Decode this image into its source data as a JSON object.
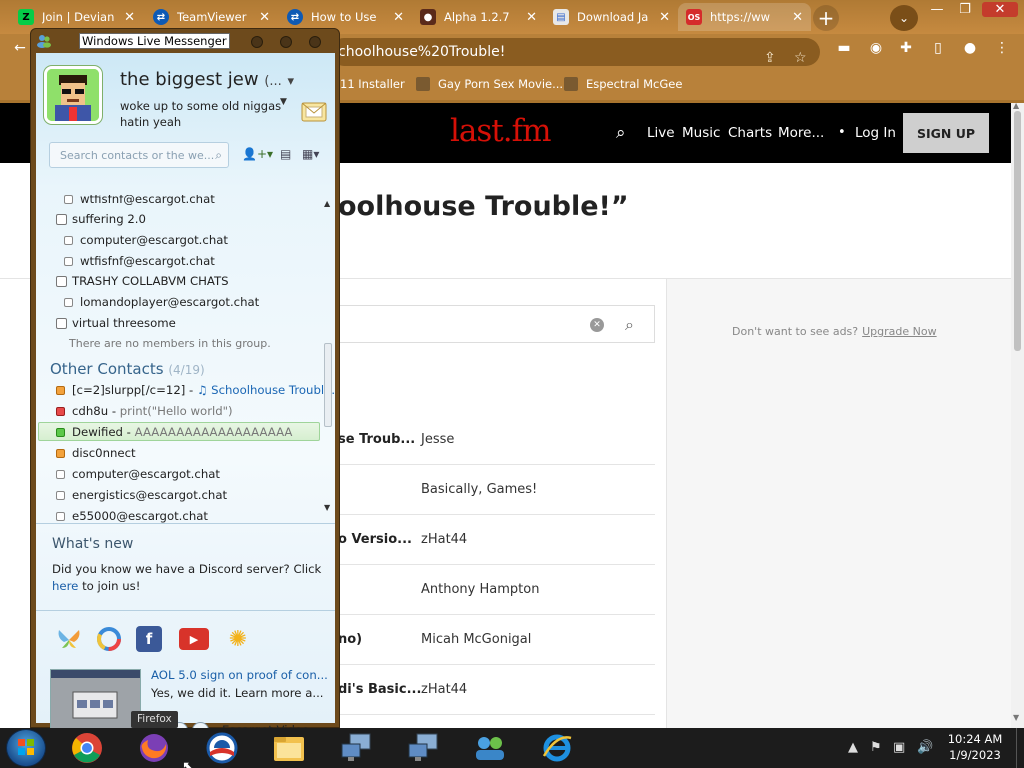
{
  "browser": {
    "tabs": [
      {
        "label": "Join | Devian",
        "icon": "deviantart-icon",
        "active": false
      },
      {
        "label": "TeamViewer",
        "icon": "teamviewer-icon",
        "active": false
      },
      {
        "label": "How to Use",
        "icon": "teamviewer-icon",
        "active": false
      },
      {
        "label": "Alpha 1.2.7",
        "icon": "game-icon",
        "active": false
      },
      {
        "label": "Download Ja",
        "icon": "document-icon",
        "active": false
      },
      {
        "label": "https://ww",
        "icon": "opensubtitles-icon",
        "active": true
      }
    ],
    "address": "choolhouse%20Trouble!",
    "bookmarks": [
      "11 Installer",
      "Gay Porn Sex Movie...",
      "Espectral McGee"
    ]
  },
  "lastfm": {
    "logo": "last.fm",
    "nav": [
      "Live",
      "Music",
      "Charts",
      "More..."
    ],
    "login": "Log In",
    "signup": "SIGN UP",
    "title": "oolhouse Trouble!”",
    "ad_text": "Don't want to see ads?",
    "ad_link": "Upgrade Now",
    "results": [
      {
        "track": "se Troub...",
        "artist": "Jesse"
      },
      {
        "track": "",
        "artist": "Basically, Games!"
      },
      {
        "track": "o Versio...",
        "artist": "zHat44"
      },
      {
        "track": "",
        "artist": "Anthony Hampton"
      },
      {
        "track": "no)",
        "artist": "Micah McGonigal"
      },
      {
        "track": "di's Basic...",
        "artist": "zHat44"
      }
    ]
  },
  "messenger": {
    "window_title": "Windows Live Messenger",
    "display_name": "the biggest jew",
    "display_name_suffix": "(...",
    "personal_message": "woke up to some old niggas hatin yeah",
    "search_placeholder": "Search contacts or the we...",
    "other_contacts_label": "Other Contacts",
    "other_contacts_count": "(4/19)",
    "list_top": [
      {
        "kind": "contact",
        "name": "wtfisfnf@escargot.chat",
        "status": "offline"
      },
      {
        "kind": "group",
        "name": "suffering 2.0"
      },
      {
        "kind": "contact",
        "name": "computer@escargot.chat",
        "status": "offline"
      },
      {
        "kind": "contact",
        "name": "wtfisfnf@escargot.chat",
        "status": "offline"
      },
      {
        "kind": "group",
        "name": "TRASHY COLLABVM CHATS"
      },
      {
        "kind": "contact",
        "name": "lomandoplayer@escargot.chat",
        "status": "offline"
      },
      {
        "kind": "group",
        "name": "virtual threesome"
      },
      {
        "kind": "empty",
        "name": "There are no members in this group."
      }
    ],
    "other_contacts": [
      {
        "name": "[c=2]slurpp[/c=12]",
        "msg": "",
        "media": "Schoolhouse Trouble...",
        "status": "away"
      },
      {
        "name": "cdh8u",
        "msg": "print(\"Hello world\")",
        "media": "",
        "status": "busy"
      },
      {
        "name": "Dewified",
        "msg": "AAAAAAAAAAAAAAAAAAA",
        "media": "",
        "status": "online"
      },
      {
        "name": "disc0nnect",
        "msg": "",
        "media": "",
        "status": "away"
      },
      {
        "name": "computer@escargot.chat",
        "msg": "",
        "media": "",
        "status": "offline"
      },
      {
        "name": "energistics@escargot.chat",
        "msg": "",
        "media": "",
        "status": "offline"
      },
      {
        "name": "e55000@escargot.chat",
        "msg": "",
        "media": "",
        "status": "offline"
      }
    ],
    "whats_new_title": "What's new",
    "whats_new_text": "Did you know we have a Discord server? Click",
    "whats_new_link": "here",
    "whats_new_end": "to join us!",
    "services": [
      "messenger-icon",
      "escargot-icon",
      "facebook-icon",
      "youtube-icon",
      "sun-icon"
    ],
    "video_title": "AOL 5.0 sign on proof of con...",
    "video_desc": "Yes, we did it. Learn more a...",
    "video_label": "Escargot Video"
  },
  "taskbar": {
    "tooltip": "Firefox",
    "apps": [
      "chrome-icon",
      "firefox-icon",
      "messenger-icon",
      "explorer-icon",
      "remote-desktop-icon",
      "remote-desktop-icon",
      "network-icon",
      "ie-icon"
    ],
    "time": "10:24 AM",
    "date": "1/9/2023"
  },
  "colors": {
    "lastfm_red": "#d51007",
    "titlebar": "#6d4a1c",
    "chrome_frame": "#b8813a"
  }
}
